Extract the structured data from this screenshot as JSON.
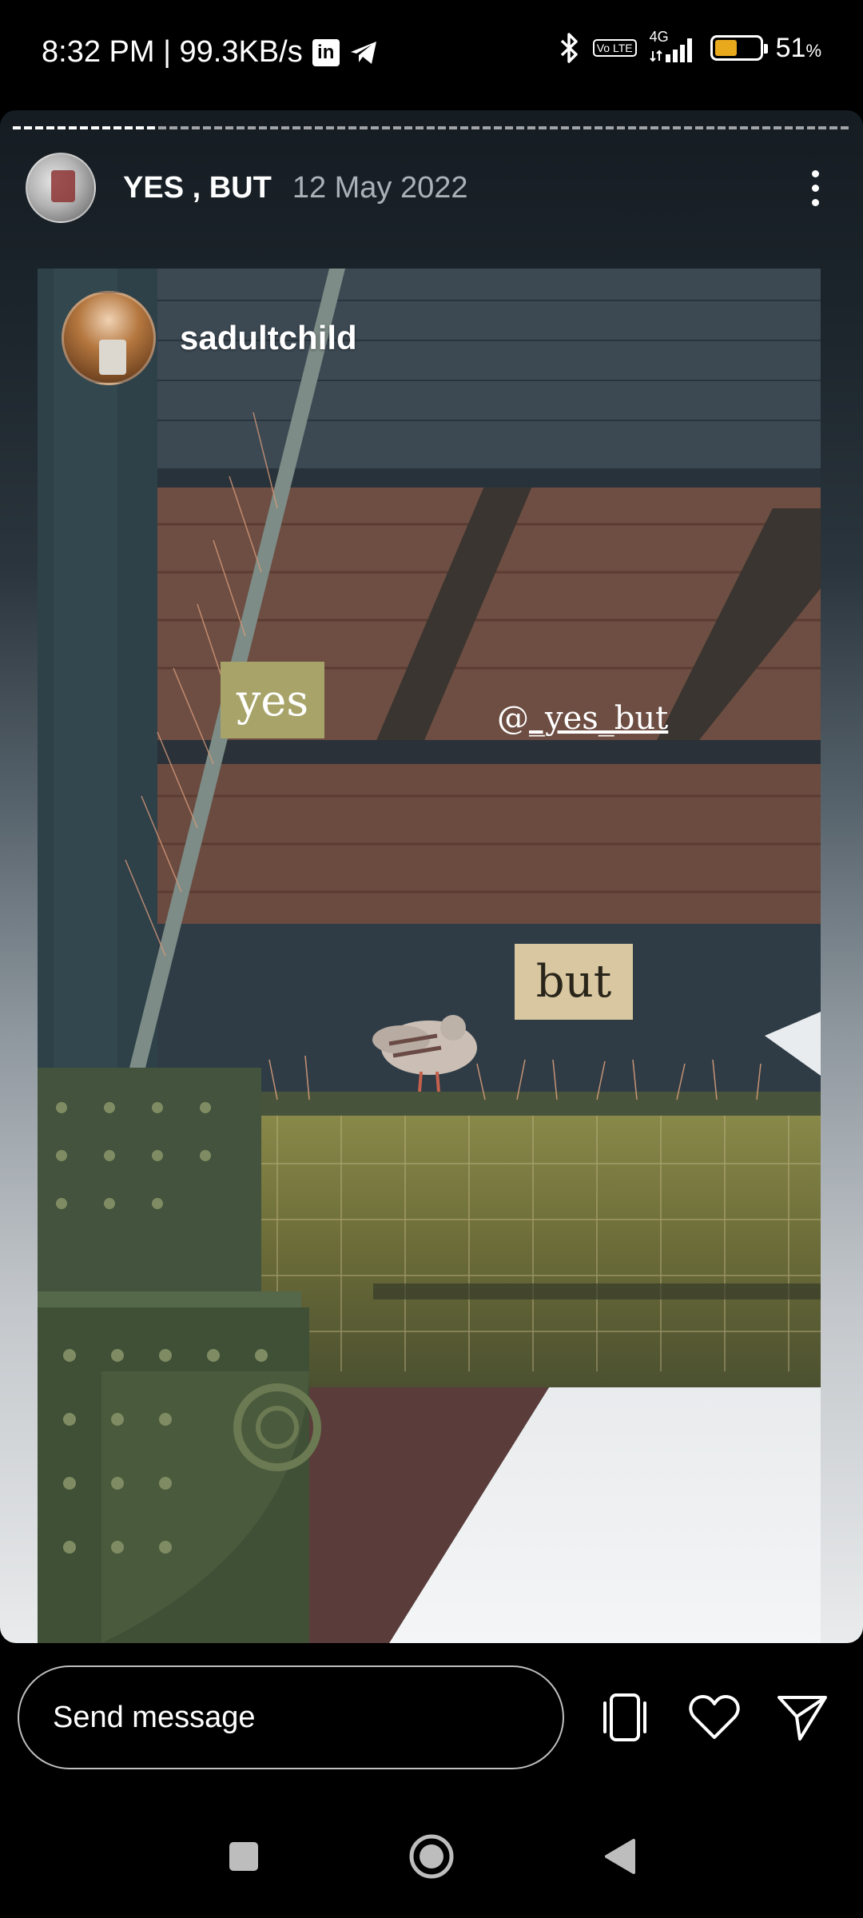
{
  "status_bar": {
    "time_speed": "8:32 PM | 99.3KB/s",
    "linkedin_icon": "linkedin-icon",
    "telegram_icon": "telegram-icon",
    "bluetooth_icon": "bluetooth-icon",
    "volte_label": "Vo LTE",
    "network_type": "4G",
    "battery_percent": "51",
    "battery_unit": "%",
    "battery_level": 0.51,
    "battery_color": "#e8a91d"
  },
  "story": {
    "progress_fraction": 0.17,
    "username": "YES , BUT",
    "date": "12 May 2022",
    "more_icon": "more-vertical-icon",
    "reshared_username": "sadultchild",
    "sticker_yes": "yes",
    "sticker_but": "but",
    "mention_at": "@",
    "mention_handle": "_yes_but"
  },
  "reply_bar": {
    "placeholder": "Send message",
    "icons": [
      "flip-phone-icon",
      "heart-icon",
      "send-icon"
    ]
  },
  "nav": {
    "icons": [
      "recents-square-icon",
      "home-circle-icon",
      "back-triangle-icon"
    ]
  },
  "colors": {
    "background": "#000000",
    "sticker_yes_bg": "#a8a469",
    "sticker_but_bg": "#d8c7a1",
    "date_text": "#aab2b8"
  }
}
